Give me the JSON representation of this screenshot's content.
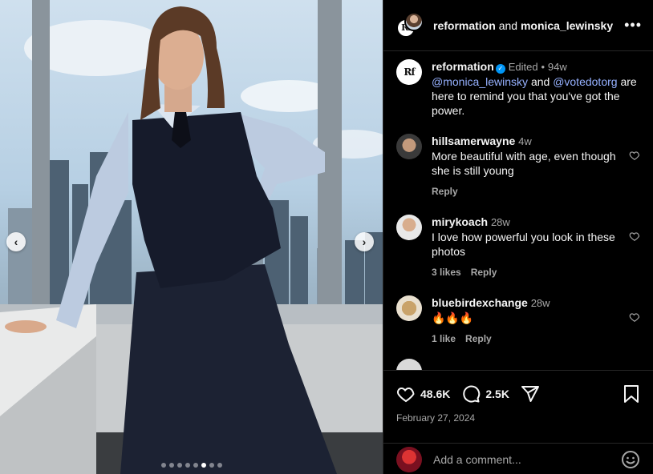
{
  "header": {
    "user1": "reformation",
    "conjunction": "and",
    "user2": "monica_lewinsky",
    "more_icon": "more-horizontal-icon"
  },
  "caption": {
    "username": "reformation",
    "verified": true,
    "edited": "Edited",
    "dot": "•",
    "time": "94w",
    "mention1": "@monica_lewinsky",
    "and_text": "and",
    "mention2": "@votedotorg",
    "text": "are here to remind you that you've got the power."
  },
  "comments": [
    {
      "username": "hillsamerwayne",
      "time": "4w",
      "text": "More beautiful with age, even though she is still young",
      "likes": "",
      "reply": "Reply"
    },
    {
      "username": "mirykoach",
      "time": "28w",
      "text": "I love how powerful you look in these photos",
      "likes": "3 likes",
      "reply": "Reply"
    },
    {
      "username": "bluebirdexchange",
      "time": "28w",
      "text": "🔥🔥🔥",
      "likes": "1 like",
      "reply": "Reply"
    }
  ],
  "actions": {
    "likes": "48.6K",
    "comments": "2.5K",
    "date": "February 27, 2024"
  },
  "add_comment": {
    "placeholder": "Add a comment..."
  },
  "carousel": {
    "total": 8,
    "active": 6,
    "prev": "‹",
    "next": "›"
  },
  "colors": {
    "background": "#000000",
    "mention": "#96b1ff",
    "verified": "#0095f6",
    "muted": "#a8a8a8"
  }
}
